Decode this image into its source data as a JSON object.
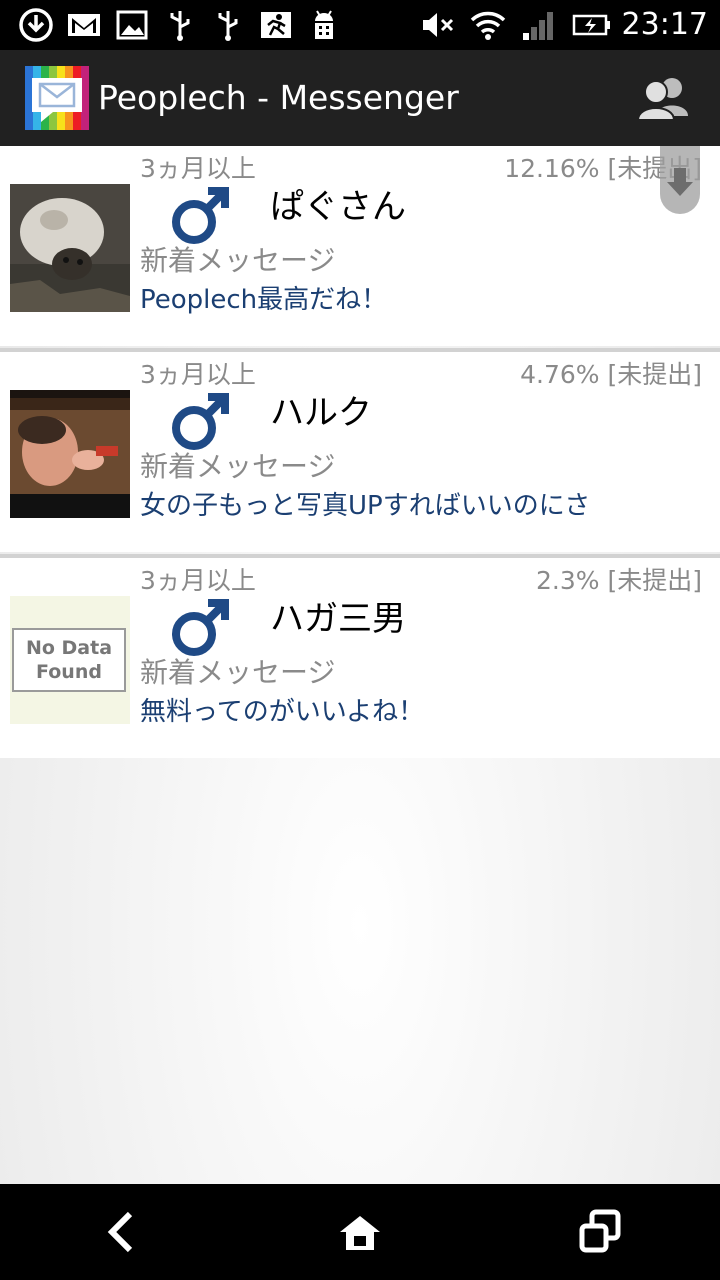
{
  "status_bar": {
    "time": "23:17",
    "icons": [
      "download-icon",
      "gmail-icon",
      "image-icon",
      "usb-icon",
      "usb-icon",
      "running-icon",
      "android-debug-icon",
      "mute-icon",
      "wifi-icon",
      "signal-icon",
      "battery-charging-icon"
    ]
  },
  "app_bar": {
    "title": "Peoplech - Messenger",
    "logo_icon": "messenger-logo-icon",
    "action_icon": "contacts-icon"
  },
  "threads": [
    {
      "last_login": "3ヵ月以上",
      "match_rate": "12.16% [未提出]",
      "gender_icon": "male-icon",
      "name": "ぱぐさん",
      "status": "新着メッセージ",
      "preview": "Peoplech最高だね！",
      "avatar": "pug-photo"
    },
    {
      "last_login": "3ヵ月以上",
      "match_rate": "4.76% [未提出]",
      "gender_icon": "male-icon",
      "name": "ハルク",
      "status": "新着メッセージ",
      "preview": "女の子もっと写真UPすればいいのにさ",
      "avatar": "man-photo"
    },
    {
      "last_login": "3ヵ月以上",
      "match_rate": "2.3% [未提出]",
      "gender_icon": "male-icon",
      "name": "ハガ三男",
      "status": "新着メッセージ",
      "preview": "無料ってのがいいよね！",
      "avatar_text": "No Data Found"
    }
  ],
  "nav_bar": {
    "icons": [
      "back-icon",
      "home-icon",
      "recents-icon"
    ]
  },
  "colors": {
    "app_bar": "#212121",
    "preview_text": "#1b3f72",
    "gender_icon": "#1f4a86",
    "meta_text": "#8a8a8a"
  }
}
